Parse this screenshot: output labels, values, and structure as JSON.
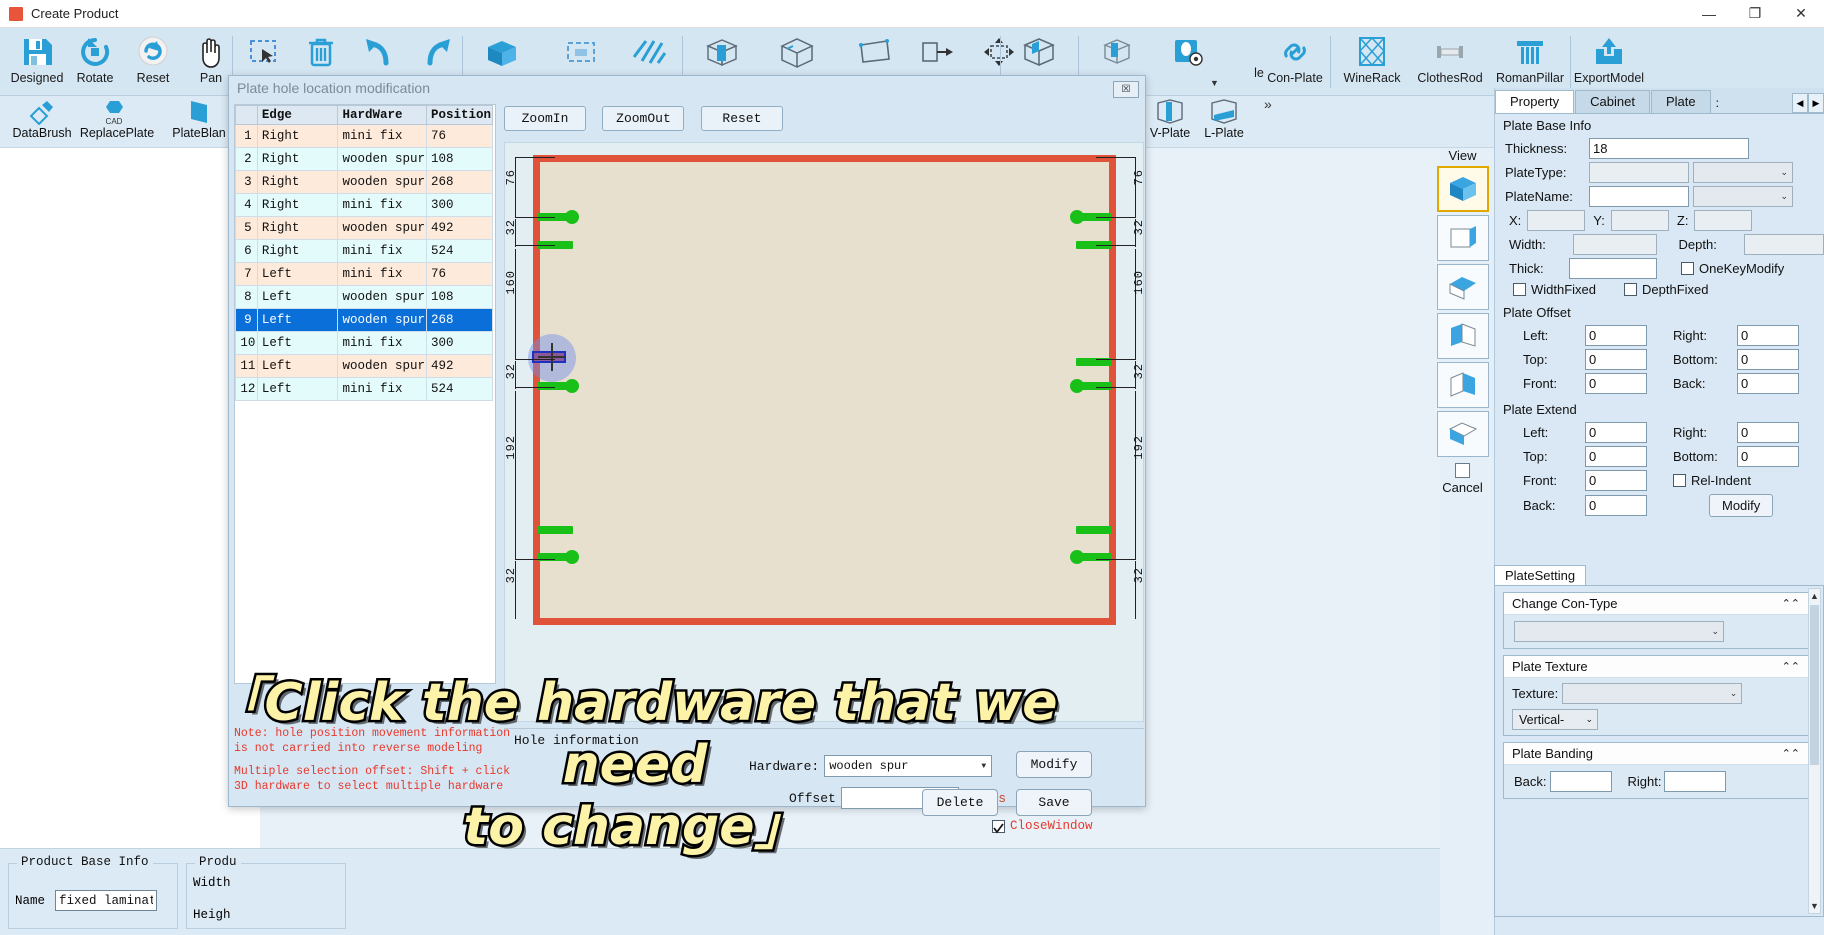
{
  "titlebar": {
    "title": "Create Product",
    "minimize": "—",
    "maximize": "❐",
    "close": "✕"
  },
  "ribbon": {
    "tools": [
      {
        "label": "Designed",
        "icon": "save-icon"
      },
      {
        "label": "Rotate",
        "icon": "rotate-ccw-icon"
      },
      {
        "label": "Reset",
        "icon": "reset-icon"
      },
      {
        "label": "Pan",
        "icon": "hand-icon"
      },
      {
        "label": "",
        "icon": "marquee-select-icon"
      },
      {
        "label": "",
        "icon": "trash-icon"
      },
      {
        "label": "",
        "icon": "undo-icon"
      },
      {
        "label": "",
        "icon": "redo-icon"
      },
      {
        "label": "",
        "icon": "cube-solid-icon"
      },
      {
        "label": "",
        "icon": "dashed-rect-icon"
      },
      {
        "label": "",
        "icon": "hatch-icon"
      },
      {
        "label": "",
        "icon": "box-open-icon"
      },
      {
        "label": "",
        "icon": "wireframe-cube-icon"
      },
      {
        "label": "",
        "icon": "quad-icon"
      },
      {
        "label": "",
        "icon": "arrow-box-icon"
      },
      {
        "label": "",
        "icon": "move-icon"
      },
      {
        "label": "",
        "icon": "panel-cube-icon"
      },
      {
        "label": "",
        "icon": "cam-cube-icon"
      },
      {
        "label": "",
        "icon": "hole-icon"
      },
      {
        "label": "le",
        "icon": "partial-label-icon"
      },
      {
        "label": "Con-Plate",
        "icon": "link-icon"
      },
      {
        "label": "WineRack",
        "icon": "winerack-icon"
      },
      {
        "label": "ClothesRod",
        "icon": "clothesrod-icon"
      },
      {
        "label": "RomanPillar",
        "icon": "pillar-icon"
      },
      {
        "label": "ExportModel",
        "icon": "export-icon"
      }
    ]
  },
  "ribbon2": {
    "tools": [
      {
        "label": "DataBrush",
        "icon": "brush-icon"
      },
      {
        "label": "ReplacePlate",
        "icon": "cad-replace-icon"
      },
      {
        "label": "PlateBlan",
        "icon": "plate-icon"
      },
      {
        "label": "V-Plate",
        "icon": "v-plate-icon"
      },
      {
        "label": "L-Plate",
        "icon": "l-plate-icon"
      }
    ],
    "overflow": "»"
  },
  "viewstrip": {
    "title": "View",
    "cancel_label": "Cancel",
    "items": [
      "iso-view",
      "front-view",
      "top-view",
      "left-view",
      "right-view",
      "bottom-view"
    ]
  },
  "dialog": {
    "title": "Plate hole location modification",
    "close_glyph": "☒",
    "table": {
      "headers": [
        "",
        "Edge",
        "HardWare",
        "Position"
      ],
      "rows": [
        {
          "n": "1",
          "edge": "Right",
          "hardware": "mini fix",
          "position": "76"
        },
        {
          "n": "2",
          "edge": "Right",
          "hardware": "wooden spur",
          "position": "108"
        },
        {
          "n": "3",
          "edge": "Right",
          "hardware": "wooden spur",
          "position": "268"
        },
        {
          "n": "4",
          "edge": "Right",
          "hardware": "mini fix",
          "position": "300"
        },
        {
          "n": "5",
          "edge": "Right",
          "hardware": "wooden spur",
          "position": "492"
        },
        {
          "n": "6",
          "edge": "Right",
          "hardware": "mini fix",
          "position": "524"
        },
        {
          "n": "7",
          "edge": "Left",
          "hardware": "mini fix",
          "position": "76"
        },
        {
          "n": "8",
          "edge": "Left",
          "hardware": "wooden spur",
          "position": "108"
        },
        {
          "n": "9",
          "edge": "Left",
          "hardware": "wooden spur",
          "position": "268"
        },
        {
          "n": "10",
          "edge": "Left",
          "hardware": "mini fix",
          "position": "300"
        },
        {
          "n": "11",
          "edge": "Left",
          "hardware": "wooden spur",
          "position": "492"
        },
        {
          "n": "12",
          "edge": "Left",
          "hardware": "mini fix",
          "position": "524"
        }
      ],
      "selected_index": 8
    },
    "zoom_in": "ZoomIn",
    "zoom_out": "ZoomOut",
    "reset": "Reset",
    "plate_dims_left": [
      "76",
      "32",
      "160",
      "32",
      "192",
      "32"
    ],
    "plate_dims_right": [
      "76",
      "32",
      "160",
      "32",
      "192",
      "32"
    ],
    "hole_information": {
      "group_label": "Hole information",
      "hardware_label": "Hardware:",
      "hardware_value": "wooden spur",
      "offset_label": "Offset",
      "offset_value": "",
      "tips_label": "Tips",
      "modify": "Modify",
      "delete": "Delete",
      "save": "Save",
      "close_window": "CloseWindow",
      "close_window_checked": true
    },
    "notes": [
      "Note: hole position movement information",
      "is not carried into reverse modeling",
      "Multiple selection offset: Shift + click",
      "3D hardware to select multiple hardware"
    ]
  },
  "caption": {
    "line1": "「Click the hardware that we need",
    "line2": "to change」"
  },
  "rightpanel": {
    "tabs": [
      {
        "label": "Property",
        "active": true
      },
      {
        "label": "Cabinet",
        "active": false
      },
      {
        "label": "Plate",
        "active": false
      }
    ],
    "tab_more": ":",
    "spin_left": "◀",
    "spin_right": "▶",
    "plate_base_info": {
      "title": "Plate Base Info",
      "thickness_label": "Thickness:",
      "thickness_value": "18",
      "platetype_label": "PlateType:",
      "platetype_value": "",
      "platename_label": "PlateName:",
      "platename_value": "",
      "x_label": "X:",
      "x_value": "",
      "y_label": "Y:",
      "y_value": "",
      "z_label": "Z:",
      "z_value": "",
      "width_label": "Width:",
      "width_value": "",
      "depth_label": "Depth:",
      "depth_value": "",
      "thick_label": "Thick:",
      "thick_value": "",
      "onekeymodify_label": "OneKeyModify",
      "widthfixed_label": "WidthFixed",
      "depthfixed_label": "DepthFixed"
    },
    "plate_offset": {
      "title": "Plate Offset",
      "left_label": "Left:",
      "left_value": "0",
      "right_label": "Right:",
      "right_value": "0",
      "top_label": "Top:",
      "top_value": "0",
      "bottom_label": "Bottom:",
      "bottom_value": "0",
      "front_label": "Front:",
      "front_value": "0",
      "back_label": "Back:",
      "back_value": "0"
    },
    "plate_extend": {
      "title": "Plate Extend",
      "left_label": "Left:",
      "left_value": "0",
      "right_label": "Right:",
      "right_value": "0",
      "top_label": "Top:",
      "top_value": "0",
      "bottom_label": "Bottom:",
      "bottom_value": "0",
      "front_label": "Front:",
      "front_value": "0",
      "back_label": "Back:",
      "back_value": "0",
      "relindent_label": "Rel-Indent",
      "modify_label": "Modify"
    },
    "plate_setting": {
      "tab_label": "PlateSetting",
      "change_con_type": {
        "title": "Change Con-Type",
        "value": ""
      },
      "plate_texture": {
        "title": "Plate Texture",
        "texture_label": "Texture:",
        "texture_value": "",
        "direction_value": "Vertical-"
      },
      "plate_banding": {
        "title": "Plate Banding",
        "back_label": "Back:",
        "back_value": "",
        "right_label": "Right:",
        "right_value": ""
      }
    }
  },
  "bottom": {
    "product_base_info": {
      "title": "Product Base Info",
      "name_label": "Name",
      "name_value": "fixed laminate p"
    },
    "product_size": {
      "title": "Produ",
      "width_label": "Width",
      "height_label": "Heigh"
    }
  }
}
